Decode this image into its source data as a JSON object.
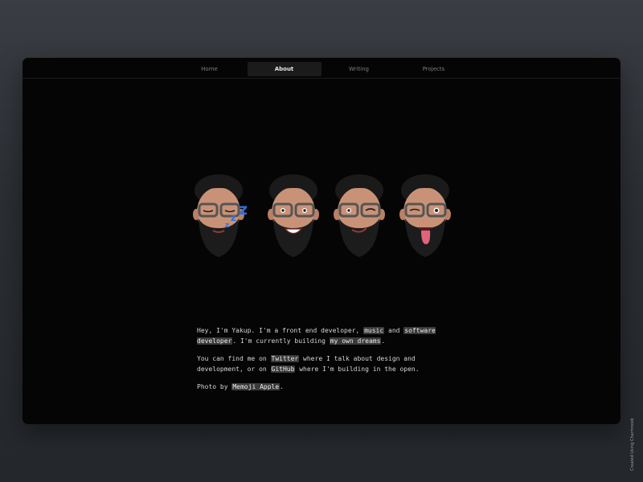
{
  "nav": {
    "items": [
      {
        "label": "Home",
        "active": false
      },
      {
        "label": "About",
        "active": true
      },
      {
        "label": "Writing",
        "active": false
      },
      {
        "label": "Projects",
        "active": false
      }
    ]
  },
  "hero": {
    "memojis": [
      "memoji-sleeping-icon",
      "memoji-smiling-icon",
      "memoji-winking-icon",
      "memoji-tongue-out-icon"
    ]
  },
  "about": {
    "p1": {
      "t1": "Hey, I'm Yakup. I'm a front end developer, ",
      "music": "music",
      "t2": " and ",
      "software_developer": "software developer",
      "t3": ". I'm currently building ",
      "dreams": "my own dreams",
      "t4": "."
    },
    "p2": {
      "t1": "You can find me on ",
      "twitter": "Twitter",
      "t2": " where I talk about design and development, or on ",
      "github": "GitHub",
      "t3": " where I'm building in the open."
    },
    "p3": {
      "t1": "Photo by ",
      "memoji": "Memoji Apple",
      "t2": "."
    }
  },
  "credit": "Created Using Charmnook",
  "colors": {
    "background": "#2b2e33",
    "window": "#050505",
    "highlight": "#3a3a3a",
    "zzz": "#2f6fe0"
  }
}
